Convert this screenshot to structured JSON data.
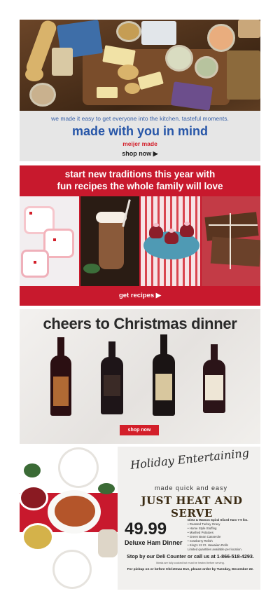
{
  "promo_meijer_made": {
    "subtitle": "we made it easy to get everyone into the kitchen. tasteful moments.",
    "title": "made with you in mind",
    "brand": "meijer made",
    "cta": "shop now ▶"
  },
  "promo_traditions": {
    "headline_line1": "start new traditions this year with",
    "headline_line2": "fun recipes the whole family will love",
    "cta": "get recipes ▶"
  },
  "promo_wine": {
    "title": "cheers to Christmas dinner",
    "cta": "shop now"
  },
  "promo_ham": {
    "script_title": "Holiday Entertaining",
    "tagline": "made quick and easy",
    "headline": "JUST HEAT AND SERVE",
    "price": "49.99",
    "product": "Deluxe Ham Dinner",
    "includes": [
      "Dietz & Watson Spiral Sliced Ham 7-9 lbs.",
      "• Roasted Turkey Gravy",
      "• Home Style Stuffing",
      "• Mashed Potatoes",
      "• Green Bean Casserole",
      "• Cranberry Relish",
      "• King's 12 Ct. Hawaiian Rolls",
      "Limited quantities available per location."
    ],
    "call": "Stop by our Deli Counter or call us at 1-866-518-4293.",
    "fine_print": "Meals are fully cooked but must be heated before serving.",
    "pickup": "For pickup on or before Christmas Eve, please order by Tuesday, December 22."
  },
  "colors": {
    "meijer_blue": "#2756a8",
    "meijer_red": "#d31f2a",
    "holiday_red": "#c8192d"
  }
}
